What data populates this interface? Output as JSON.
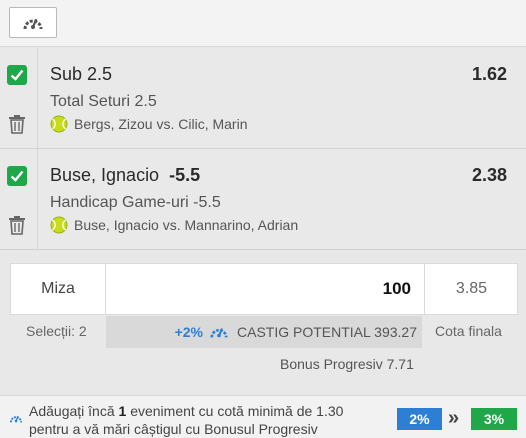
{
  "toolbar": {
    "icon": "gauge-icon"
  },
  "selections": [
    {
      "checked": true,
      "pick": "Sub 2.5",
      "line": "",
      "odds": "1.62",
      "market": "Total Seturi 2.5",
      "event": "Bergs, Zizou vs. Cilic, Marin",
      "sport_icon": "tennis-ball-icon"
    },
    {
      "checked": true,
      "pick": "Buse, Ignacio",
      "line": "-5.5",
      "odds": "2.38",
      "market": "Handicap Game-uri -5.5",
      "event": "Buse, Ignacio vs. Mannarino, Adrian",
      "sport_icon": "tennis-ball-icon"
    }
  ],
  "stake": {
    "label": "Miza",
    "value": "100",
    "total_odds": "3.85"
  },
  "summary": {
    "selections": "Selecții: 2",
    "bonus_pct": "+2%",
    "potential": "CASTIG POTENTIAL 393.27",
    "cota": "Cota finala",
    "bonus": "Bonus Progresiv 7.71"
  },
  "footer": {
    "text_before": "Adăugați încă ",
    "count": "1",
    "text_after": " eveniment cu cotă minimă de 1.30 pentru a vă mări câștigul cu Bonusul Progresiv",
    "current": "2%",
    "arrow": "»",
    "next": "3%"
  },
  "colors": {
    "green": "#1fa74a",
    "blue": "#2d7fd3",
    "tennis": "#c8dc1e"
  }
}
